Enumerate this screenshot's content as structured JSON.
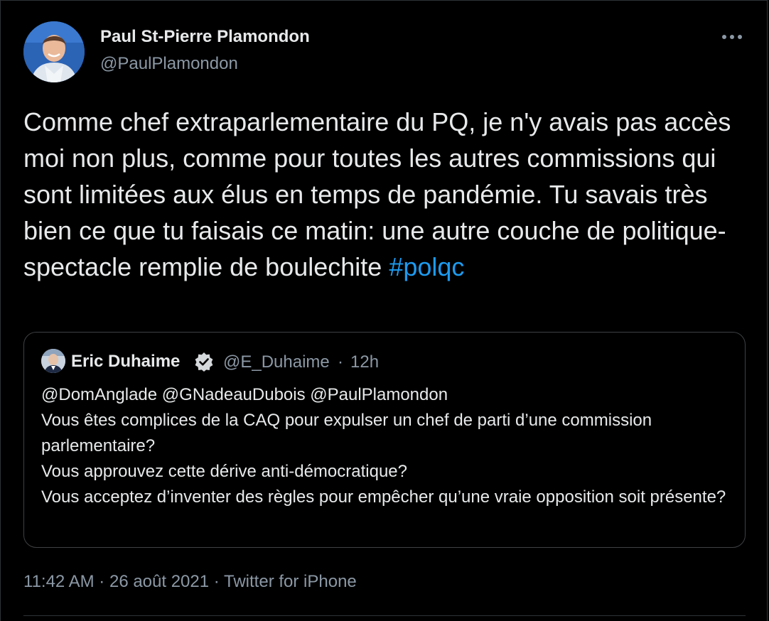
{
  "tweet": {
    "author_name": "Paul St-Pierre Plamondon",
    "author_handle": "@PaulPlamondon",
    "text": "Comme chef extraparlementaire du PQ, je n'y avais pas accès moi non plus, comme pour toutes les autres commissions qui sont limitées aux élus en temps de pandémie. Tu savais très bien ce que tu faisais ce matin: une autre couche de politique-spectacle remplie de boulechite ",
    "hashtag": "#polqc",
    "time": "11:42 AM",
    "date": "26 août 2021",
    "source": "Twitter for iPhone",
    "sep": "·"
  },
  "quote": {
    "author_name": "Eric Duhaime",
    "verified_icon": "verified-badge-icon",
    "author_handle": "@E_Duhaime",
    "sep": "·",
    "time": "12h",
    "lines": [
      "@DomAnglade @GNadeauDubois @PaulPlamondon",
      "Vous êtes complices de la CAQ pour expulser un chef de parti d’une commission parlementaire?",
      "Vous approuvez cette dérive anti-démocratique?",
      "Vous acceptez d’inventer des règles pour empêcher qu’une vraie opposition soit présente?"
    ]
  },
  "icons": {
    "more": "more-options-icon",
    "avatar": "avatar"
  },
  "colors": {
    "background": "#000000",
    "text": "#e7e9ea",
    "muted": "#8b98a5",
    "link": "#1d9bf0",
    "border": "#3e4144"
  }
}
